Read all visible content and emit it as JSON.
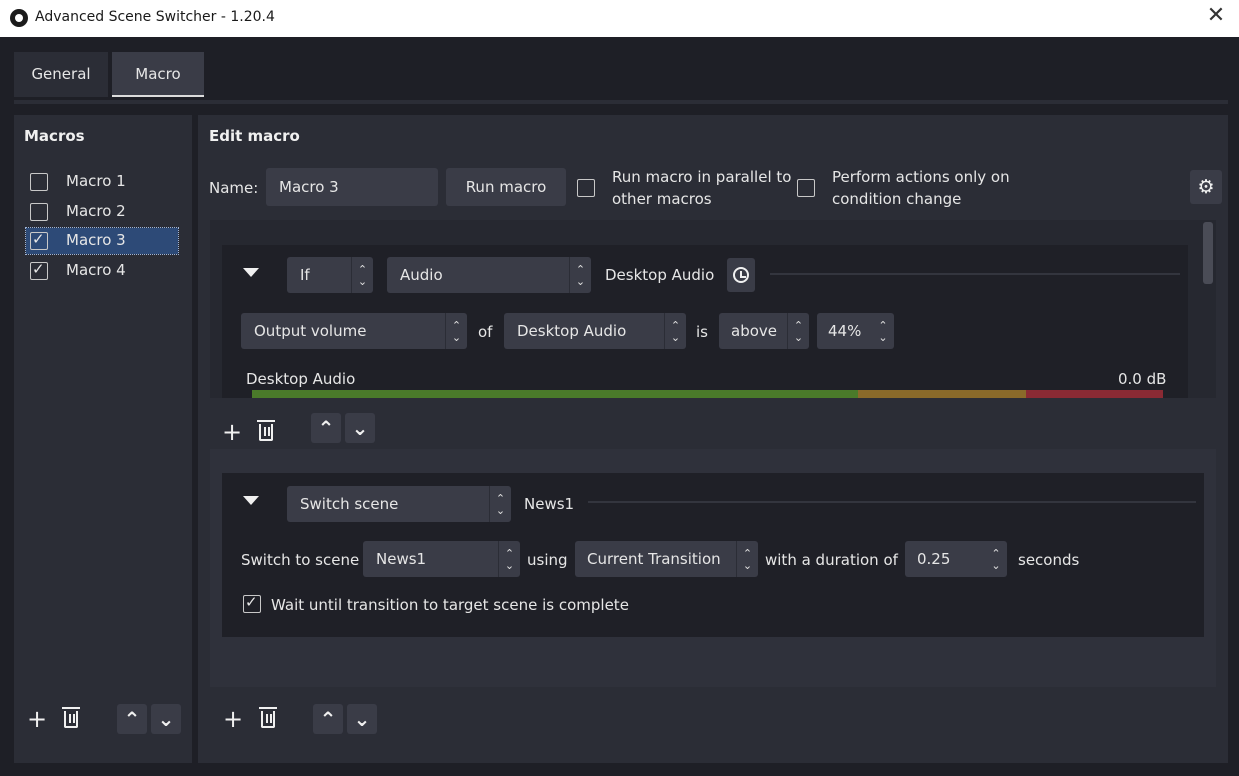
{
  "window": {
    "title": "Advanced Scene Switcher - 1.20.4",
    "close_glyph": "✕"
  },
  "tabs": [
    {
      "label": "General"
    },
    {
      "label": "Macro",
      "active": true
    }
  ],
  "macros": {
    "title": "Macros",
    "items": [
      {
        "label": "Macro 1",
        "checked": false
      },
      {
        "label": "Macro 2",
        "checked": false
      },
      {
        "label": "Macro 3",
        "checked": true,
        "selected": true
      },
      {
        "label": "Macro 4",
        "checked": true
      }
    ]
  },
  "edit": {
    "title": "Edit macro",
    "name_label": "Name:",
    "name_value": "Macro 3",
    "run_button": "Run macro",
    "parallel_label_1": "Run macro in parallel to",
    "parallel_label_2": "other macros",
    "perform_label_1": "Perform actions only on",
    "perform_label_2": "condition change"
  },
  "condition": {
    "logic": "If",
    "type": "Audio",
    "header_summary": "Desktop Audio",
    "check": "Output volume",
    "of_label": "of",
    "source": "Desktop Audio",
    "is_label": "is",
    "comparison": "above",
    "volume": "44%",
    "meter_label": "Desktop Audio",
    "meter_db": "0.0 dB"
  },
  "action": {
    "type": "Switch scene",
    "header_summary": "News1",
    "switch_label": "Switch to scene",
    "scene": "News1",
    "using_label": "using",
    "transition": "Current Transition",
    "duration_label": "with a duration of",
    "duration": "0.25",
    "seconds_label": "seconds",
    "wait_label": "Wait until transition to target scene is complete",
    "wait_checked": true
  },
  "glyphs": {
    "plus": "+",
    "up": "⌃",
    "down": "⌄",
    "gear": "⚙"
  }
}
